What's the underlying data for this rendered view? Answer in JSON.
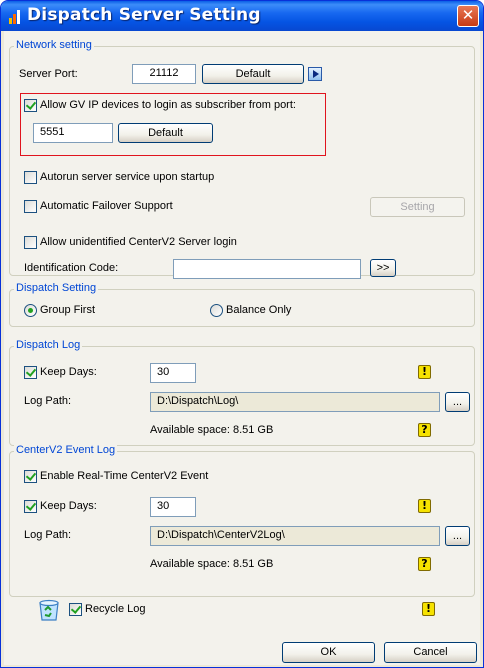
{
  "window": {
    "title": "Dispatch Server Setting",
    "close_glyph": "✕"
  },
  "network": {
    "group_title": "Network setting",
    "server_port_label": "Server Port:",
    "server_port_value": "21112",
    "default_label": "Default",
    "allow_gv_label": "Allow GV IP devices to login as subscriber from port:",
    "allow_gv_checked": true,
    "subscriber_port_value": "5551",
    "subscriber_default_label": "Default",
    "autorun_label": "Autorun server service upon startup",
    "autorun_checked": false,
    "failover_label": "Automatic Failover Support",
    "failover_checked": false,
    "setting_label": "Setting",
    "allow_unidentified_label": "Allow unidentified CenterV2 Server login",
    "allow_unidentified_checked": false,
    "identification_label": "Identification Code:",
    "identification_value": "",
    "more_button_label": ">>"
  },
  "dispatch_setting": {
    "group_title": "Dispatch Setting",
    "group_first_label": "Group First",
    "group_first_selected": true,
    "balance_only_label": "Balance Only",
    "balance_only_selected": false
  },
  "dispatch_log": {
    "group_title": "Dispatch Log",
    "keep_days_label": "Keep Days:",
    "keep_days_checked": true,
    "keep_days_value": "30",
    "log_path_label": "Log Path:",
    "log_path_value": "D:\\Dispatch\\Log\\",
    "browse_label": "...",
    "available_space": "Available space: 8.51 GB",
    "warning_glyph": "!",
    "help_glyph": "?"
  },
  "centerv2_log": {
    "group_title": "CenterV2 Event Log",
    "enable_label": "Enable Real-Time CenterV2 Event",
    "enable_checked": true,
    "keep_days_label": "Keep Days:",
    "keep_days_checked": true,
    "keep_days_value": "30",
    "log_path_label": "Log Path:",
    "log_path_value": "D:\\Dispatch\\CenterV2Log\\",
    "browse_label": "...",
    "available_space": "Available space: 8.51 GB",
    "warning_glyph": "!",
    "help_glyph": "?"
  },
  "recycle": {
    "label": "Recycle Log",
    "checked": true,
    "icon": "recycle-bin-icon",
    "warning_glyph": "!"
  },
  "footer": {
    "ok_label": "OK",
    "cancel_label": "Cancel"
  }
}
